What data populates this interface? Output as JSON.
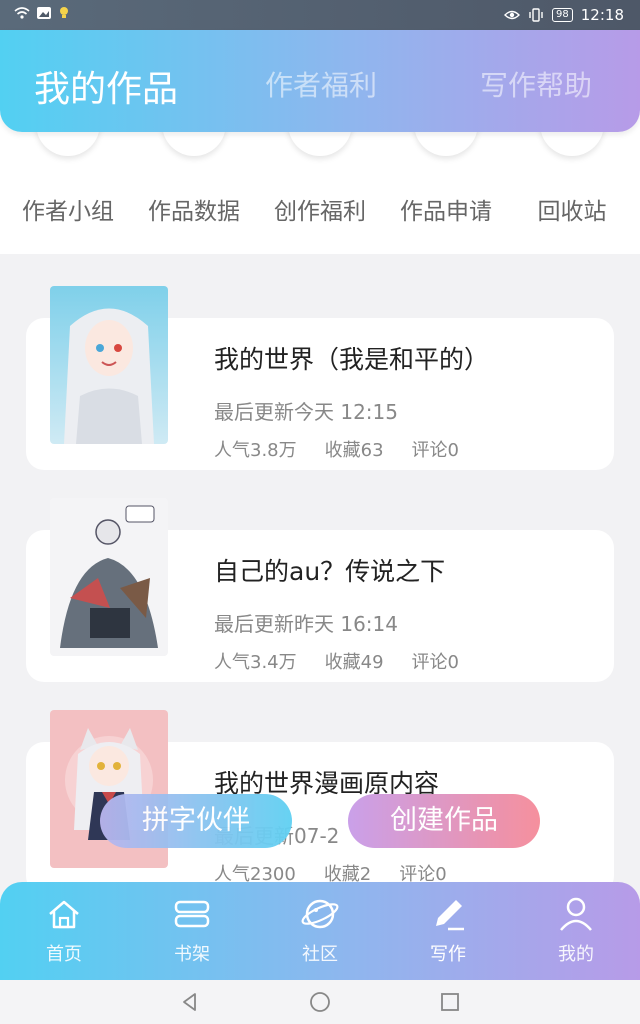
{
  "status_bar": {
    "battery": "98",
    "time": "12:18"
  },
  "header": {
    "tabs": [
      {
        "label": "我的作品",
        "active": true
      },
      {
        "label": "作者福利",
        "active": false
      },
      {
        "label": "写作帮助",
        "active": false
      }
    ]
  },
  "quick_actions": [
    {
      "label": "作者小组"
    },
    {
      "label": "作品数据"
    },
    {
      "label": "创作福利"
    },
    {
      "label": "作品申请"
    },
    {
      "label": "回收站"
    }
  ],
  "works": [
    {
      "title": "我的世界（我是和平的）",
      "updated": "最后更新今天 12:15",
      "popularity": "人气3.8万",
      "favorites": "收藏63",
      "comments": "评论0"
    },
    {
      "title": "自己的au？传说之下",
      "updated": "最后更新昨天 16:14",
      "popularity": "人气3.4万",
      "favorites": "收藏49",
      "comments": "评论0"
    },
    {
      "title": "我的世界漫画原内容",
      "updated": "最后更新07-2",
      "popularity": "人气2300",
      "favorites": "收藏2",
      "comments": "评论0"
    }
  ],
  "fab": {
    "partner": "拼字伙伴",
    "create": "创建作品"
  },
  "tabbar": {
    "items": [
      {
        "label": "首页",
        "icon": "home-icon"
      },
      {
        "label": "书架",
        "icon": "bookshelf-icon"
      },
      {
        "label": "社区",
        "icon": "community-planet-icon"
      },
      {
        "label": "写作",
        "icon": "write-pen-icon"
      },
      {
        "label": "我的",
        "icon": "profile-icon"
      }
    ]
  }
}
